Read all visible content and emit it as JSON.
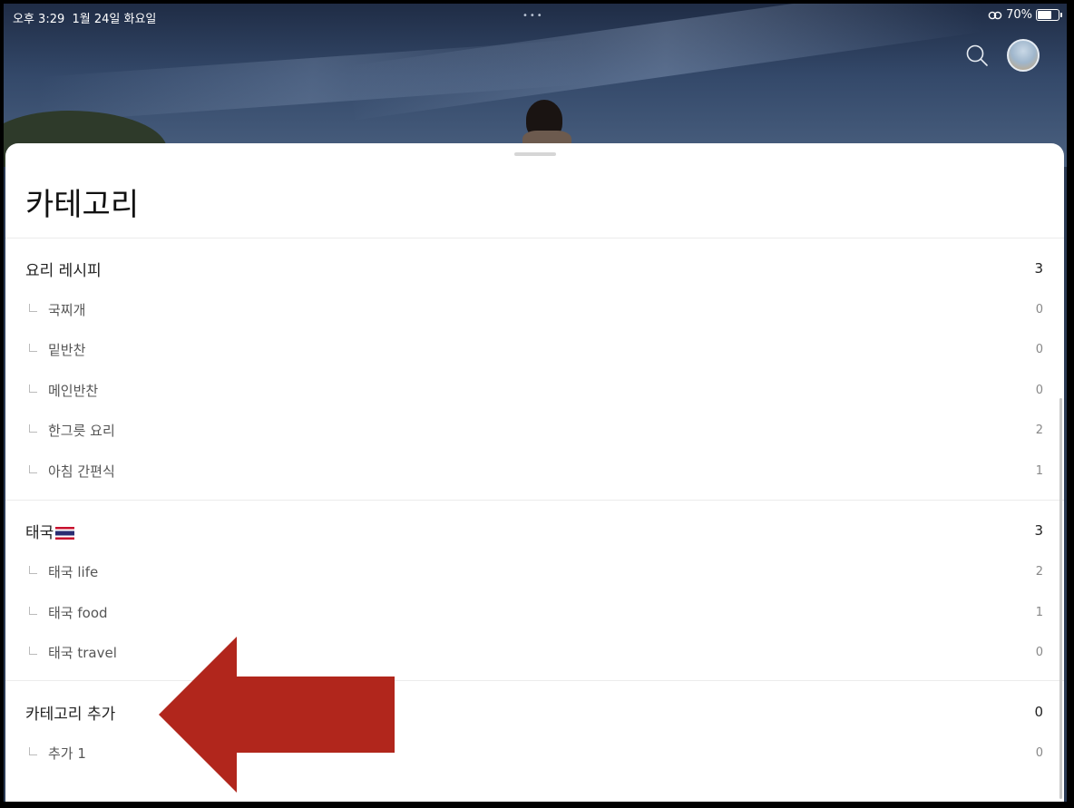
{
  "status_bar": {
    "time": "오후 3:29",
    "date": "1월 24일 화요일",
    "battery_percent": "70%",
    "battery_level": 0.7
  },
  "header": {
    "search_icon": "search-icon",
    "avatar": "profile-avatar"
  },
  "sheet": {
    "title": "카테고리"
  },
  "categories": [
    {
      "name": "요리 레시피",
      "count": "3",
      "children": [
        {
          "name": "국찌개",
          "count": "0"
        },
        {
          "name": "밑반찬",
          "count": "0"
        },
        {
          "name": "메인반찬",
          "count": "0"
        },
        {
          "name": "한그릇 요리",
          "count": "2"
        },
        {
          "name": "아침 간편식",
          "count": "1"
        }
      ]
    },
    {
      "name": "태국",
      "flag": "thailand-flag-icon",
      "count": "3",
      "children": [
        {
          "name": "태국 life",
          "count": "2"
        },
        {
          "name": "태국 food",
          "count": "1"
        },
        {
          "name": "태국 travel",
          "count": "0"
        }
      ]
    },
    {
      "name": "카테고리 추가",
      "count": "0",
      "children": [
        {
          "name": "추가 1",
          "count": "0"
        }
      ]
    }
  ],
  "colors": {
    "arrow": "#b1261c",
    "sheet_bg": "#ffffff"
  }
}
